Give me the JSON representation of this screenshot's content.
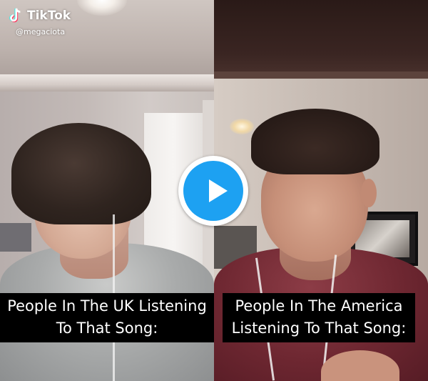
{
  "watermark": {
    "brand": "TikTok",
    "handle": "@megaciota",
    "icon": "tiktok-note-icon"
  },
  "captions": {
    "left": {
      "line1": "People In The UK Listening",
      "line2": "To That Song:"
    },
    "right": {
      "line1": "People In The America",
      "line2": "Listening To That Song:"
    }
  },
  "play_button": {
    "icon": "play-icon",
    "color": "#1da1f2"
  },
  "colors": {
    "caption_bg": "#000000",
    "caption_text": "#ffffff"
  }
}
